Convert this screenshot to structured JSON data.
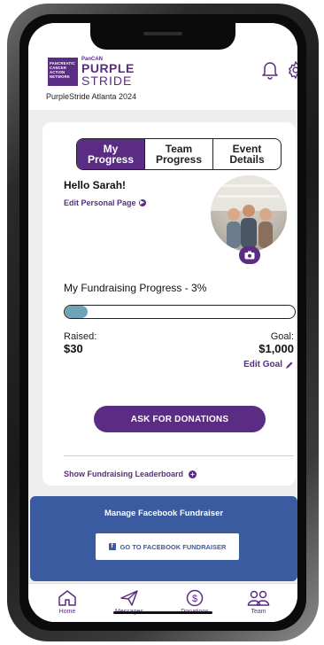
{
  "header": {
    "logo_box_text": "PANCREATIC CANCER ACTION NETWORK",
    "logo_small": "PanCAN",
    "logo_purple": "PURPLE",
    "logo_stride": "STRIDE",
    "event_name": "PurpleStride Atlanta 2024",
    "bell_icon": "bell-icon",
    "gear_icon": "gear-icon"
  },
  "tabs": [
    {
      "label": "My\nProgress",
      "active": true
    },
    {
      "label": "Team\nProgress",
      "active": false
    },
    {
      "label": "Event\nDetails",
      "active": false
    }
  ],
  "profile": {
    "greeting": "Hello Sarah!",
    "edit_page_label": "Edit Personal Page"
  },
  "fundraising": {
    "title": "My Fundraising Progress - 3%",
    "progress_fraction": 0.1,
    "raised_label": "Raised:",
    "raised_value": "$30",
    "goal_label": "Goal:",
    "goal_value": "$1,000",
    "edit_goal_label": "Edit Goal"
  },
  "actions": {
    "ask_button": "ASK FOR DONATIONS",
    "leaderboard_link": "Show Fundraising Leaderboard"
  },
  "facebook": {
    "title": "Manage Facebook Fundraiser",
    "button_label": "GO TO FACEBOOK FUNDRAISER"
  },
  "nav": [
    {
      "label": "Home",
      "icon": "home-icon"
    },
    {
      "label": "Messages",
      "icon": "send-icon"
    },
    {
      "label": "Donations",
      "icon": "dollar-icon"
    },
    {
      "label": "Team",
      "icon": "team-icon"
    }
  ],
  "colors": {
    "brand_purple": "#5b2c83",
    "progress_fill": "#6fa3b8",
    "facebook_blue": "#3b5ba0"
  }
}
